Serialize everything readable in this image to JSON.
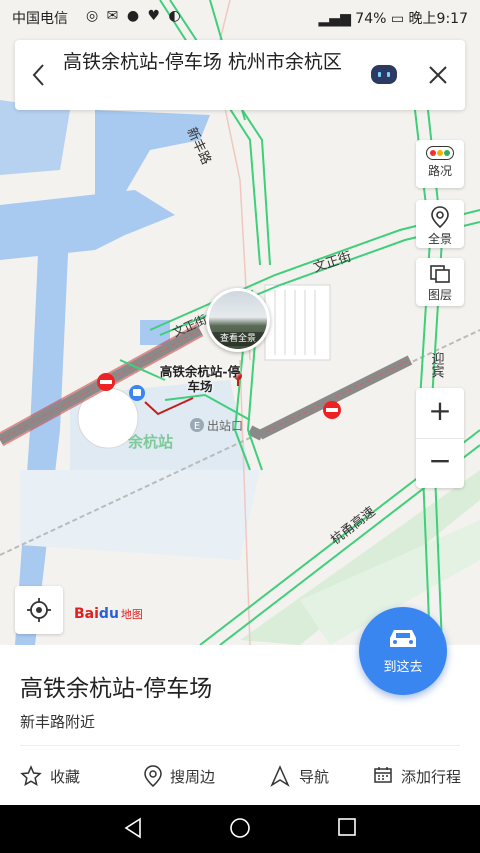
{
  "status_bar": {
    "carrier": "中国电信",
    "battery": "74%",
    "time": "晚上9:17",
    "icons": [
      "wifi-icon",
      "signal-icon",
      "notification-icon"
    ]
  },
  "search_bar": {
    "title": "高铁余杭站-停车场 杭州市余杭区"
  },
  "map": {
    "road_labels": {
      "xinfeng_road": "新丰路",
      "wenzheng_street": "文正街",
      "wenzheng_street_2": "文正街",
      "yingbin": "迎宾",
      "hangnan_expressway": "杭甬高速"
    },
    "station_label": "余杭站",
    "exit_label": "出站口",
    "exit_marker": "E",
    "poi_label": "高铁余杭站-停车场",
    "pano_caption": "查看全景",
    "logo": {
      "bai": "Bai",
      "du": "du",
      "ditu": "地图"
    },
    "colors": {
      "road_green": "#3fcf7a",
      "accent_blue": "#3a86f0",
      "rail_red": "#c43b3b"
    }
  },
  "side_controls": {
    "traffic": "路况",
    "panorama": "全景",
    "layers": "图层",
    "zoom_in": "+",
    "zoom_out": "−"
  },
  "goto_button": {
    "label": "到这去"
  },
  "poi_card": {
    "title": "高铁余杭站-停车场",
    "address": "新丰路附近",
    "actions": [
      {
        "label": "收藏",
        "icon": "star-icon"
      },
      {
        "label": "搜周边",
        "icon": "location-pin-icon"
      },
      {
        "label": "导航",
        "icon": "navigation-arrow-icon"
      },
      {
        "label": "添加行程",
        "icon": "calendar-icon"
      }
    ]
  }
}
